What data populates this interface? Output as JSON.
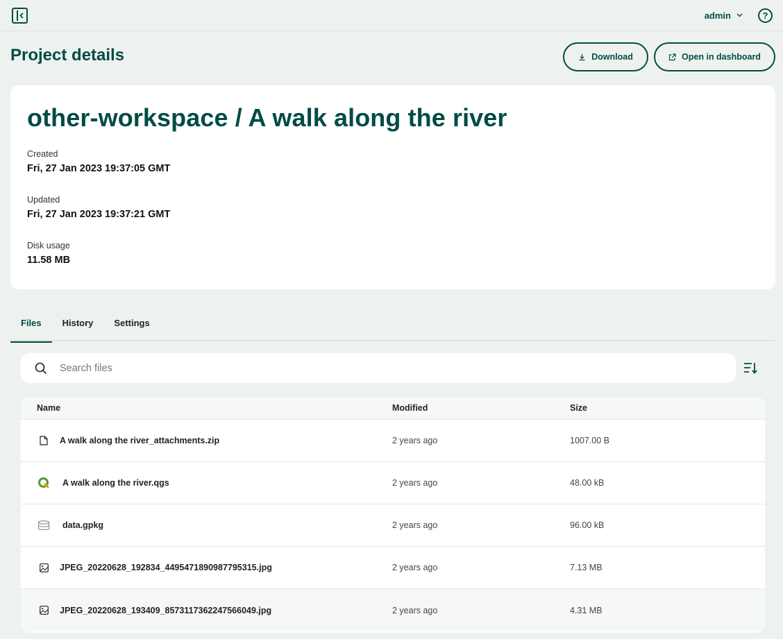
{
  "topbar": {
    "user": "admin"
  },
  "page": {
    "title": "Project details",
    "download_label": "Download",
    "open_dashboard_label": "Open in dashboard"
  },
  "project": {
    "name": "other-workspace / A walk along the river",
    "created_label": "Created",
    "created_value": "Fri, 27 Jan 2023 19:37:05 GMT",
    "updated_label": "Updated",
    "updated_value": "Fri, 27 Jan 2023 19:37:21 GMT",
    "disk_label": "Disk usage",
    "disk_value": "11.58 MB"
  },
  "tabs": [
    {
      "label": "Files",
      "active": true
    },
    {
      "label": "History",
      "active": false
    },
    {
      "label": "Settings",
      "active": false
    }
  ],
  "search": {
    "placeholder": "Search files"
  },
  "table": {
    "headers": {
      "name": "Name",
      "modified": "Modified",
      "size": "Size"
    },
    "rows": [
      {
        "icon": "file-icon",
        "name": "A walk along the river_attachments.zip",
        "modified": "2 years ago",
        "size": "1007.00 B"
      },
      {
        "icon": "qgis-icon",
        "name": "A walk along the river.qgs",
        "modified": "2 years ago",
        "size": "48.00 kB"
      },
      {
        "icon": "database-icon",
        "name": "data.gpkg",
        "modified": "2 years ago",
        "size": "96.00 kB"
      },
      {
        "icon": "image-icon",
        "name": "JPEG_20220628_192834_4495471890987795315.jpg",
        "modified": "2 years ago",
        "size": "7.13 MB"
      },
      {
        "icon": "image-icon",
        "name": "JPEG_20220628_193409_8573117362247566049.jpg",
        "modified": "2 years ago",
        "size": "4.31 MB"
      }
    ]
  },
  "colors": {
    "accent": "#004c45",
    "background": "#eef2ef",
    "qgis_green": "#589632"
  }
}
